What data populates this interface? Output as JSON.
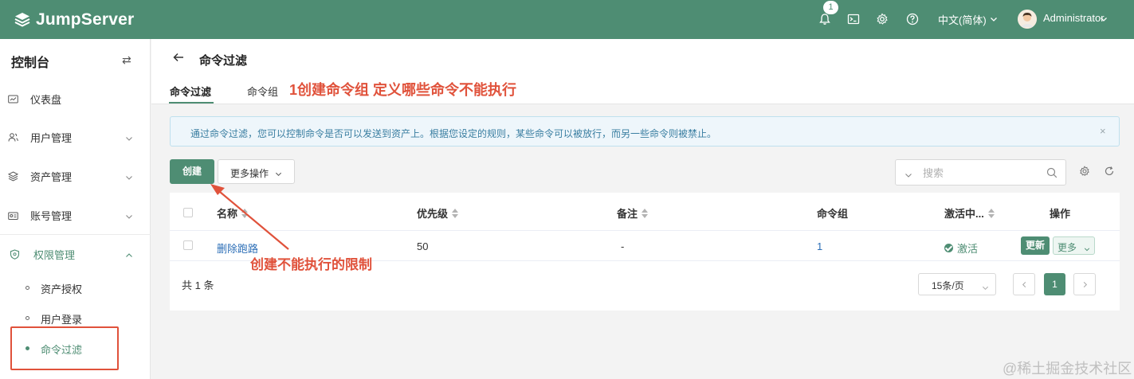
{
  "topbar": {
    "logo_text": "JumpServer",
    "notification_count": "1",
    "language": "中文(简体)",
    "user_name": "Administrator",
    "bg_color": "#4e8d73"
  },
  "sidebar": {
    "title": "控制台",
    "switch_icon": "⇄",
    "items": [
      {
        "label": "仪表盘",
        "icon": "dashboard-icon"
      },
      {
        "label": "用户管理",
        "icon": "users-icon"
      },
      {
        "label": "资产管理",
        "icon": "assets-icon"
      },
      {
        "label": "账号管理",
        "icon": "accounts-icon"
      },
      {
        "label": "权限管理",
        "icon": "shield-icon"
      }
    ],
    "subitems": [
      {
        "label": "资产授权"
      },
      {
        "label": "用户登录"
      },
      {
        "label": "命令过滤"
      }
    ]
  },
  "page": {
    "title": "命令过滤",
    "tabs": [
      {
        "label": "命令过滤"
      },
      {
        "label": "命令组"
      }
    ],
    "annotation_top": "1创建命令组 定义哪些命令不能执行",
    "alert_text": "通过命令过滤，您可以控制命令是否可以发送到资产上。根据您设定的规则，某些命令可以被放行，而另一些命令则被禁止。",
    "alert_close": "×"
  },
  "toolbar": {
    "create_label": "创建",
    "more_label": "更多操作",
    "search_placeholder": "搜索"
  },
  "table": {
    "columns": [
      "名称",
      "优先级",
      "备注",
      "命令组",
      "激活中...",
      "操作"
    ],
    "rows": [
      {
        "name": "删除跑路",
        "priority": "50",
        "comment": "-",
        "command_groups": "1",
        "status": "激活",
        "update_label": "更新",
        "more_label": "更多"
      }
    ],
    "total": "共 1 条",
    "page_size": "15条/页",
    "current_page": "1"
  },
  "annotations": {
    "middle": "创建不能执行的限制",
    "color": "#e0523b"
  },
  "watermark": "@稀土掘金技术社区"
}
